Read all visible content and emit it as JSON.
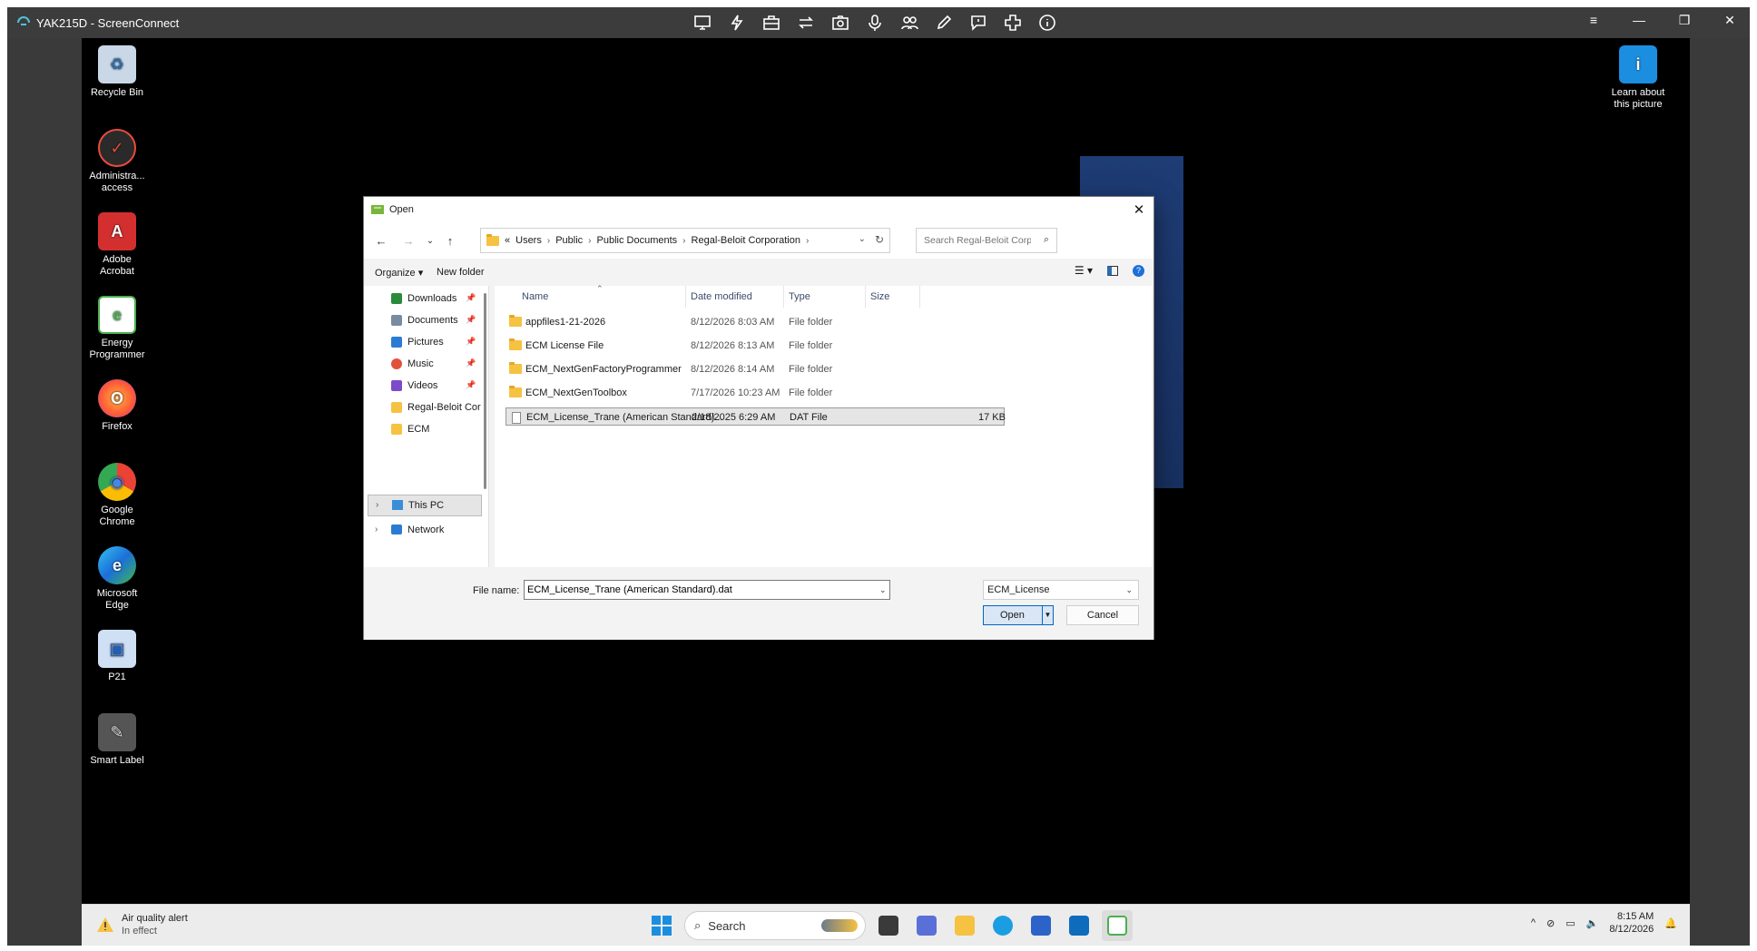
{
  "viewer": {
    "title": "YAK215D - ScreenConnect",
    "toolbar_icons": [
      "monitor-icon",
      "lightning-icon",
      "toolbox-icon",
      "swap-icon",
      "camera-icon",
      "microphone-icon",
      "users-icon",
      "pencil-icon",
      "chat-icon",
      "plus-icon",
      "info-icon"
    ],
    "window_controls": [
      "≡",
      "—",
      "❐",
      "✕"
    ]
  },
  "desktop": {
    "icons": [
      {
        "label": "Recycle Bin",
        "color": "#c9d7e6",
        "glyph": "♻"
      },
      {
        "label": "Administra... access",
        "color": "#c0392b",
        "glyph": "✓"
      },
      {
        "label": "Adobe Acrobat",
        "color": "#d32f2f",
        "glyph": "A"
      },
      {
        "label": "Energy Programmer",
        "color": "#4caf50",
        "glyph": "e"
      },
      {
        "label": "Firefox",
        "color": "#ff7139",
        "glyph": "ʘ"
      },
      {
        "label": "Google Chrome",
        "color": "#34a853",
        "glyph": "◉"
      },
      {
        "label": "Microsoft Edge",
        "color": "#1b9de2",
        "glyph": "e"
      },
      {
        "label": "P21",
        "color": "#3f7fd8",
        "glyph": "▣"
      },
      {
        "label": "Smart Label",
        "color": "#8d8d8d",
        "glyph": "✎"
      }
    ],
    "learn": {
      "label": "Learn about this picture"
    }
  },
  "dialog": {
    "title": "Open",
    "breadcrumb": [
      "«",
      "Users",
      "Public",
      "Public Documents",
      "Regal-Beloit Corporation"
    ],
    "search_placeholder": "Search Regal-Beloit Corpor...",
    "organize": "Organize ▾",
    "new_folder": "New folder",
    "nav_items": [
      {
        "label": "Downloads",
        "color": "#2a8a3a",
        "pinned": true
      },
      {
        "label": "Documents",
        "color": "#7a8aa0",
        "pinned": true
      },
      {
        "label": "Pictures",
        "color": "#2b7bd3",
        "pinned": true
      },
      {
        "label": "Music",
        "color": "#e0533a",
        "pinned": true
      },
      {
        "label": "Videos",
        "color": "#7b4bc9",
        "pinned": true
      },
      {
        "label": "Regal-Beloit Cor",
        "color": "#f5c242",
        "pinned": false
      },
      {
        "label": "ECM",
        "color": "#f5c242",
        "pinned": false
      }
    ],
    "this_pc": "This PC",
    "network": "Network",
    "columns": {
      "name": "Name",
      "date": "Date modified",
      "type": "Type",
      "size": "Size"
    },
    "files": [
      {
        "name": "appfiles1-21-2026",
        "date": "8/12/2026 8:03 AM",
        "type": "File folder",
        "size": "",
        "kind": "folder"
      },
      {
        "name": "ECM License File",
        "date": "8/12/2026 8:13 AM",
        "type": "File folder",
        "size": "",
        "kind": "folder"
      },
      {
        "name": "ECM_NextGenFactoryProgrammer",
        "date": "8/12/2026 8:14 AM",
        "type": "File folder",
        "size": "",
        "kind": "folder"
      },
      {
        "name": "ECM_NextGenToolbox",
        "date": "7/17/2026 10:23 AM",
        "type": "File folder",
        "size": "",
        "kind": "folder"
      },
      {
        "name": "ECM_License_Trane (American Standard)...",
        "date": "2/18/2025 6:29 AM",
        "type": "DAT File",
        "size": "17 KB",
        "kind": "file"
      }
    ],
    "file_name_label": "File name:",
    "file_name_value": "ECM_License_Trane (American Standard).dat",
    "filter": "ECM_License",
    "open": "Open",
    "cancel": "Cancel"
  },
  "taskbar": {
    "weather_title": "Air quality alert",
    "weather_sub": "In effect",
    "search": "Search",
    "apps": [
      {
        "name": "files-app",
        "color": "#3a3a3a"
      },
      {
        "name": "m365-app",
        "color": "#5b6fd8"
      },
      {
        "name": "explorer-app",
        "color": "#f5c242"
      },
      {
        "name": "edge-app",
        "color": "#1b9de2"
      },
      {
        "name": "store-app",
        "color": "#2b63c8"
      },
      {
        "name": "outlook-app",
        "color": "#0f6cbd"
      },
      {
        "name": "energy-app",
        "color": "#4caf50"
      }
    ],
    "time": "8:15 AM",
    "date": "8/12/2026"
  }
}
